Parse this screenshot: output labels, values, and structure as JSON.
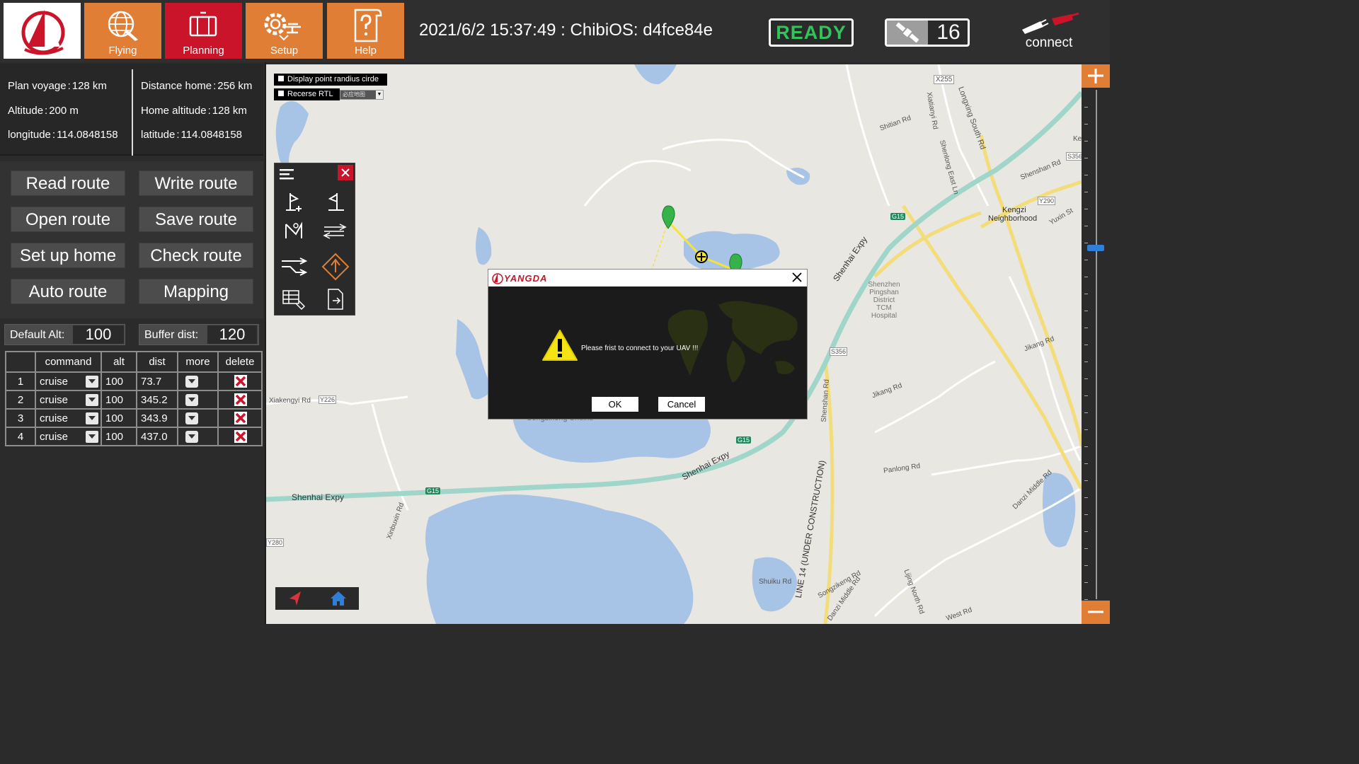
{
  "topbar": {
    "nav": [
      {
        "label": "Flying",
        "icon": "globe-plane-icon"
      },
      {
        "label": "Planning",
        "icon": "route-map-icon"
      },
      {
        "label": "Setup",
        "icon": "gear-drone-icon"
      },
      {
        "label": "Help",
        "icon": "help-scroll-icon"
      }
    ],
    "active_nav": "Planning",
    "status_text": "2021/6/2 15:37:49 : ChibiOS: d4fce84e",
    "ready_label": "READY",
    "satellite_count": "16",
    "connect_label": "connect"
  },
  "info": {
    "plan_voyage": {
      "label": "Plan voyage",
      "value": "128 km"
    },
    "altitude": {
      "label": "Altitude",
      "value": "200 m"
    },
    "longitude": {
      "label": "longitude",
      "value": "114.0848158"
    },
    "distance_home": {
      "label": "Distance home",
      "value": "256 km"
    },
    "home_altitude": {
      "label": "Home altitude",
      "value": "128 km"
    },
    "latitude": {
      "label": "latitude",
      "value": "114.0848158"
    }
  },
  "route_buttons": {
    "read": "Read route",
    "write": "Write route",
    "open": "Open route",
    "save": "Save route",
    "set_home": "Set up home",
    "check": "Check route",
    "auto": "Auto route",
    "mapping": "Mapping"
  },
  "fields": {
    "default_alt": {
      "label": "Default Alt:",
      "value": "100"
    },
    "buffer_dist": {
      "label": "Buffer dist:",
      "value": "120"
    }
  },
  "table": {
    "headers": [
      "command",
      "alt",
      "dist",
      "more",
      "delete"
    ],
    "rows": [
      {
        "num": "1",
        "command": "cruise",
        "alt": "100",
        "dist": "73.7"
      },
      {
        "num": "2",
        "command": "cruise",
        "alt": "100",
        "dist": "345.2"
      },
      {
        "num": "3",
        "command": "cruise",
        "alt": "100",
        "dist": "343.9"
      },
      {
        "num": "4",
        "command": "cruise",
        "alt": "100",
        "dist": "437.0"
      }
    ]
  },
  "map": {
    "display_point_label": "Display point randius cirde",
    "reverse_rtl_label": "Recerse RTL",
    "map_source": "必应地图",
    "labels": {
      "x255": "X255",
      "shitian": "Shitian Rd",
      "xiatianyi": "Xiatianyi Rd",
      "longxing": "Longxing South Rd",
      "shenlong": "Shenlong East Ln",
      "ke": "Ke",
      "s356a": "S356",
      "shenshan_rd": "Shenshan Rd",
      "y290": "Y290",
      "kengzi": "Kengzi",
      "neighborhood": "Neighborhood",
      "yuxin": "Yuxin St",
      "g15a": "G15",
      "shenhai_a": "Shenhai Expy",
      "hospital": "Shenzhen Pingshan District TCM Hospital",
      "s356b": "S356",
      "jikang": "Jikang Rd",
      "jikang2": "Jikang Rd",
      "xiakengyi": "Xiakengyi Rd",
      "y226": "Y226",
      "songzikeng": "Songzikeng Shuiku",
      "g15b": "G15",
      "shenhai_b": "Shenhai Expy",
      "g15c": "G15",
      "shenhai_c": "Shenhai Expy",
      "xinbuxin": "Xinbuxin Rd",
      "y280": "Y280",
      "line14": "LINE 14 (UNDER CONSTRUCTION)",
      "shenshan2": "Shenshan Rd",
      "panlong": "Panlong Rd",
      "danzi_mid": "Danzi Middle Rd",
      "shuiku": "Shuiku Rd",
      "songzikeng_rd": "Songzikeng Rd",
      "danzi_mid2": "Danzi Middle Rd",
      "lijing": "Lijing North Rd",
      "westrd": "West Rd"
    }
  },
  "dialog": {
    "brand": "YANGDA",
    "message": "Please frist to connect to your UAV !!!",
    "ok_label": "OK",
    "cancel_label": "Cancel"
  },
  "colors": {
    "accent_orange": "#e07e35",
    "active_red": "#c9142a",
    "ready_green": "#32c45a",
    "route_yellow": "#f3e33a",
    "expressway": "#9fd6c9"
  }
}
